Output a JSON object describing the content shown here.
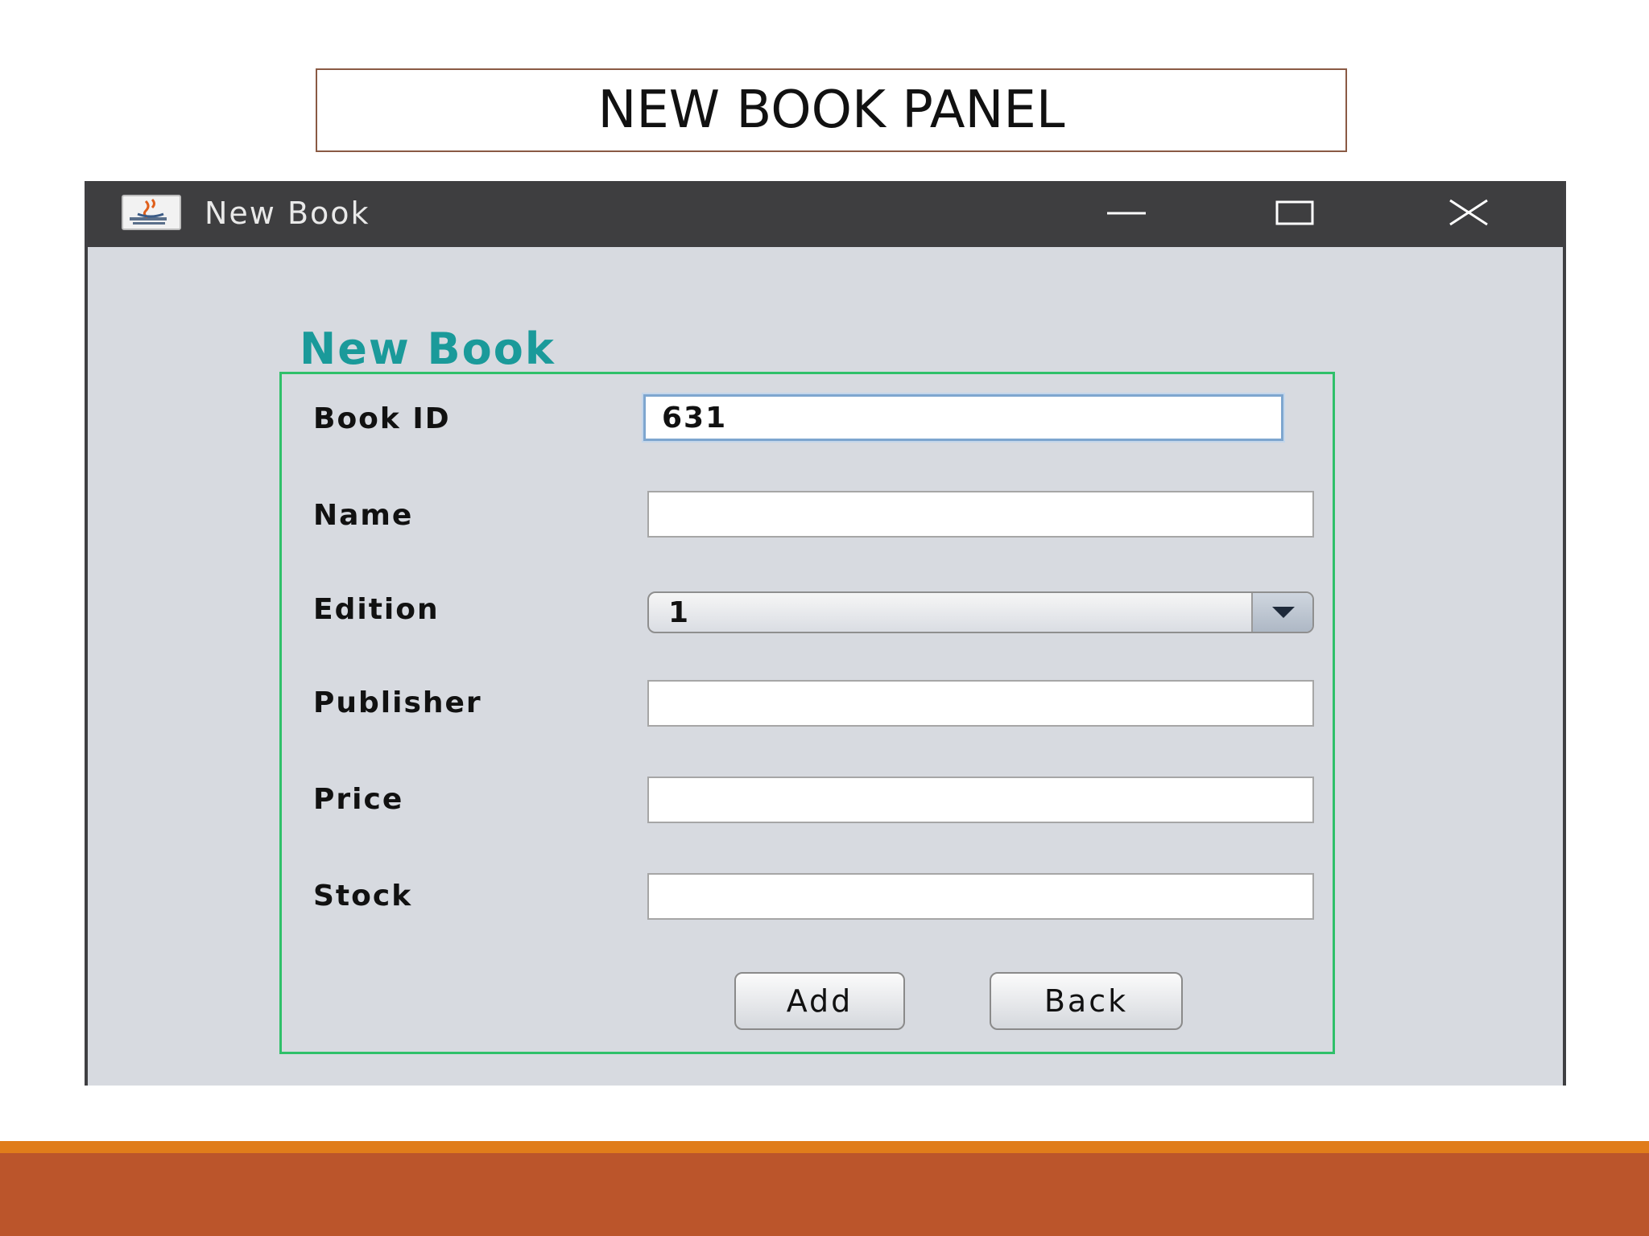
{
  "slide": {
    "title": "NEW BOOK PANEL"
  },
  "window": {
    "title": "New Book",
    "icon": "java-app-icon",
    "controls": [
      "minimize-icon",
      "maximize-icon",
      "close-icon"
    ]
  },
  "form": {
    "heading": "New Book",
    "fields": {
      "book_id": {
        "label": "Book ID",
        "value": "631"
      },
      "name": {
        "label": "Name",
        "value": ""
      },
      "edition": {
        "label": "Edition",
        "selected": "1"
      },
      "publisher": {
        "label": "Publisher",
        "value": ""
      },
      "price": {
        "label": "Price",
        "value": ""
      },
      "stock": {
        "label": "Stock",
        "value": ""
      }
    },
    "buttons": {
      "add": "Add",
      "back": "Back"
    }
  },
  "colors": {
    "heading": "#1a9a9a",
    "panel_border": "#2fc06a",
    "title_bar": "#3e3e40",
    "footer_accent": "#e07c1a",
    "footer_band": "#bb552b"
  }
}
